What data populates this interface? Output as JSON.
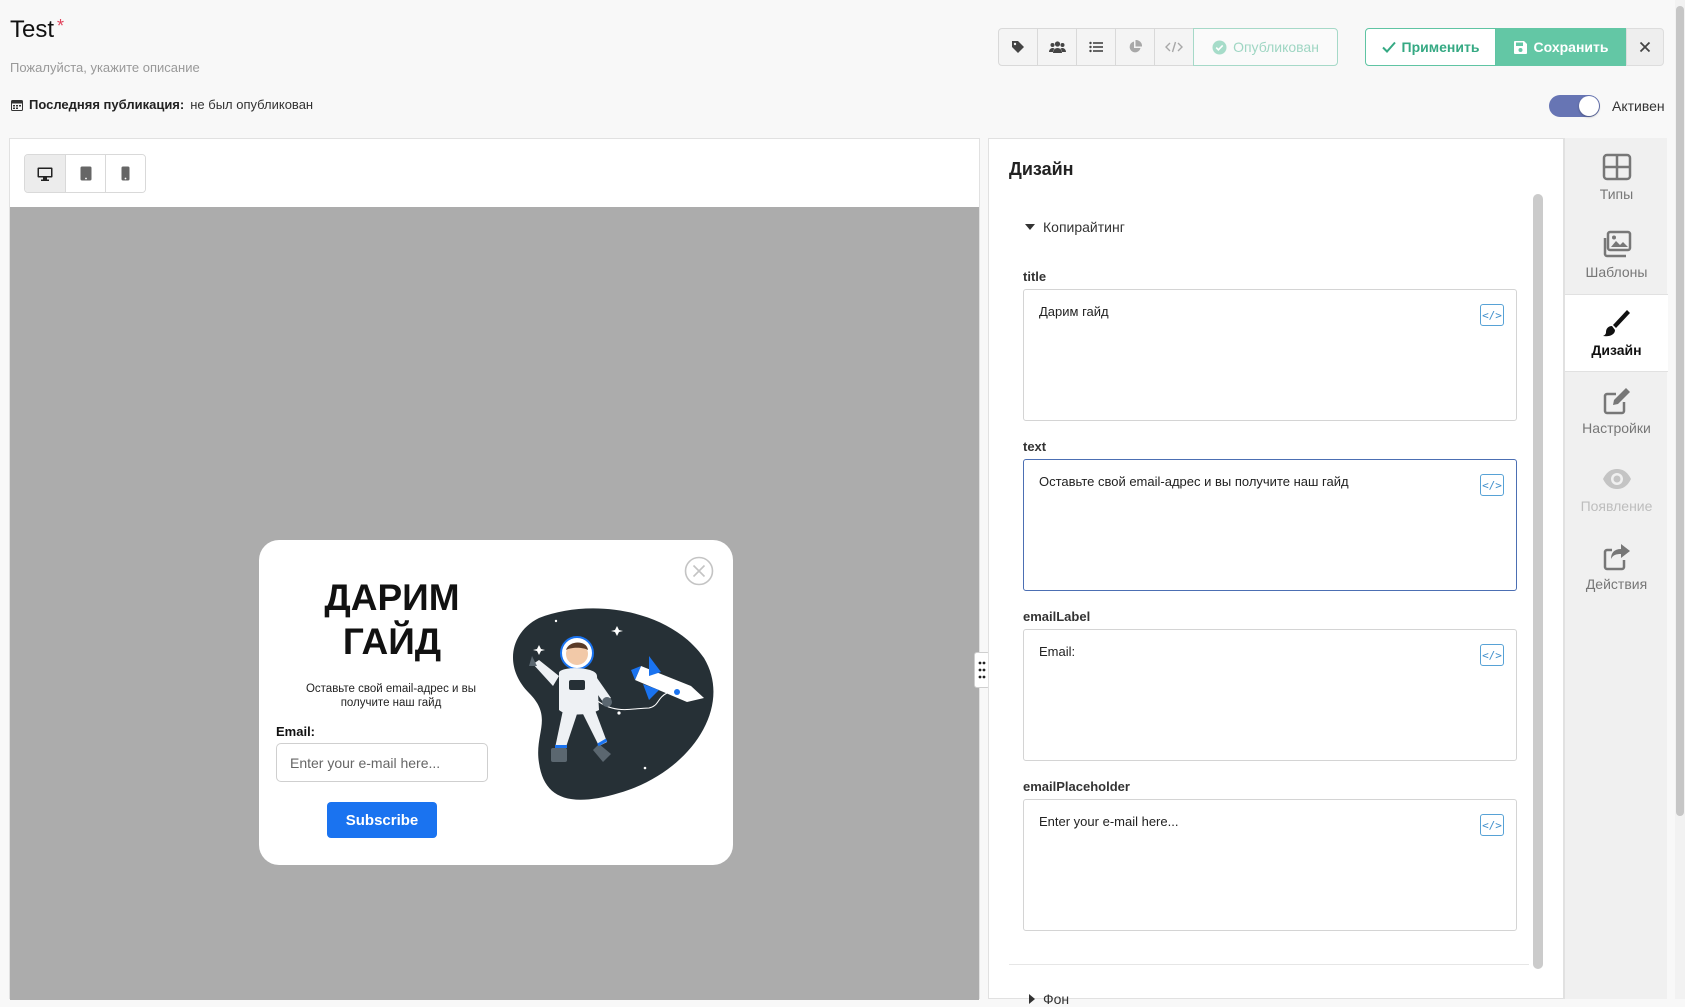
{
  "header": {
    "title": "Test",
    "required_mark": "*",
    "subtitle": "Пожалуйста, укажите описание",
    "last_publication_label": "Последняя публикация:",
    "last_publication_value": "не был опубликован",
    "published_label": "Опубликован",
    "apply_label": "Применить",
    "save_label": "Сохранить",
    "active_label": "Активен",
    "active": true
  },
  "toolbar_icons": [
    "tag-icon",
    "users-icon",
    "list-icon",
    "pie-chart-icon",
    "code-icon"
  ],
  "preview": {
    "devices": [
      "desktop-icon",
      "tablet-icon",
      "mobile-icon"
    ],
    "popup": {
      "title": "Дарим гайд",
      "text": "Оставьте свой email-адрес и вы получите наш гайд",
      "email_label": "Email:",
      "email_placeholder": "Enter your e-mail here...",
      "button": "Subscribe"
    }
  },
  "design_panel": {
    "heading": "Дизайн",
    "section": "Копирайтинг",
    "fields": [
      {
        "label": "title",
        "value": "Дарим гайд"
      },
      {
        "label": "text",
        "value": "Оставьте свой email-адрес и вы получите наш гайд"
      },
      {
        "label": "emailLabel",
        "value": "Email:"
      },
      {
        "label": "emailPlaceholder",
        "value": "Enter your e-mail here..."
      }
    ],
    "next_section": "Фон",
    "code_icon_glyph": "</>"
  },
  "sidebar": {
    "items": [
      {
        "label": "Типы",
        "icon": "grid-icon"
      },
      {
        "label": "Шаблоны",
        "icon": "images-icon"
      },
      {
        "label": "Дизайн",
        "icon": "brush-icon"
      },
      {
        "label": "Настройки",
        "icon": "edit-icon"
      },
      {
        "label": "Появление",
        "icon": "eye-icon"
      },
      {
        "label": "Действия",
        "icon": "share-icon"
      }
    ],
    "active": "Дизайн"
  },
  "colors": {
    "accent_green": "#63c7a5",
    "toggle": "#6775b4",
    "subscribe": "#1a73f0",
    "canvas": "#acacac"
  }
}
